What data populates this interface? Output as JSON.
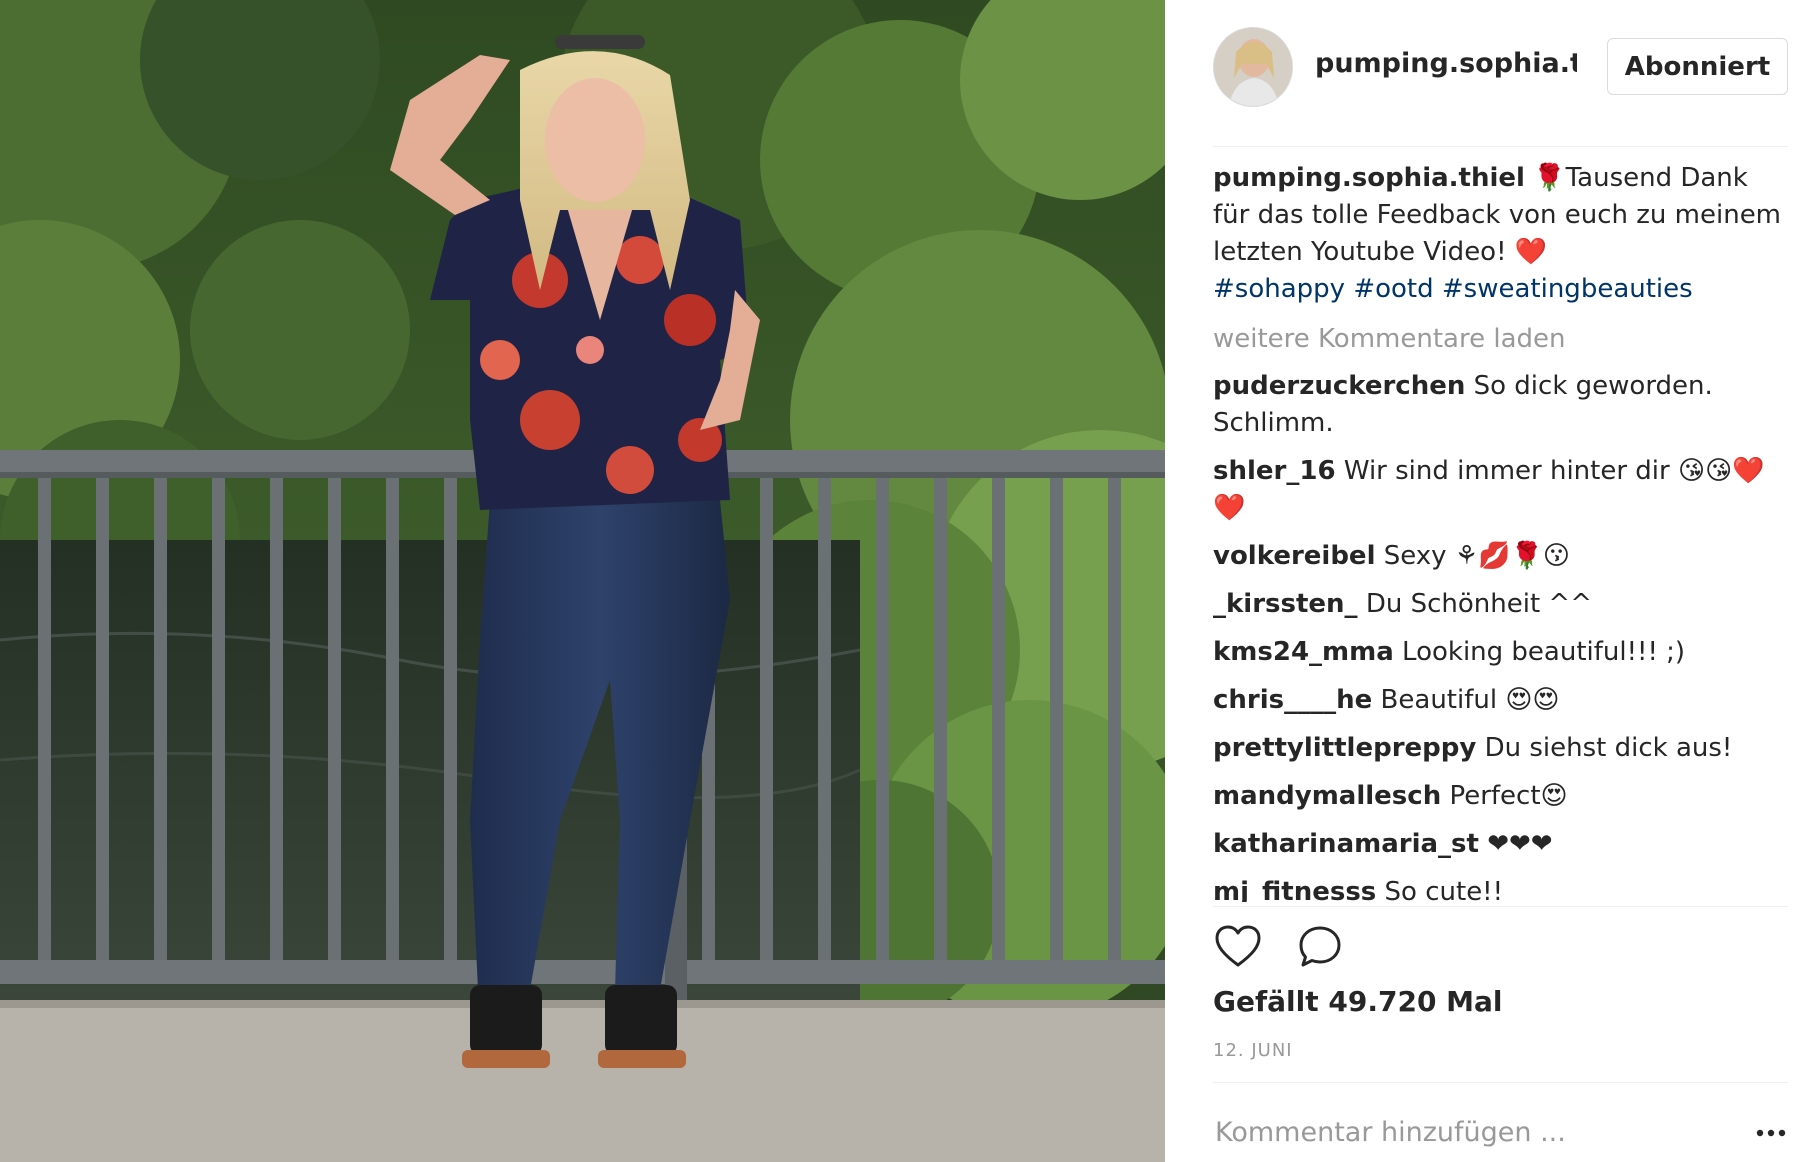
{
  "photo": {
    "alt": "Woman in floral blouse and jeans on a bridge"
  },
  "post": {
    "header_username": "pumping.sophia.thiel",
    "follow_label": "Abonniert",
    "caption": {
      "username": "pumping.sophia.thiel",
      "text": " 🌹Tausend Dank für das tolle Feedback von euch zu meinem letzten Youtube Video! ❤️",
      "hashtags": [
        "#sohappy",
        "#ootd",
        "#sweatingbeauties"
      ]
    },
    "load_more": "weitere Kommentare laden",
    "comments": [
      {
        "username": "puderzuckerchen",
        "text": "So dick geworden. Schlimm."
      },
      {
        "username": "shler_16",
        "text": "Wir sind immer hinter dir 😘😘❤️❤️"
      },
      {
        "username": "volkereibel",
        "text": "Sexy ⚘💋🌹😗"
      },
      {
        "username": "_kirssten_",
        "text": "Du Schönheit ^^"
      },
      {
        "username": "kms24_mma",
        "text": "Looking beautiful!!! ;)"
      },
      {
        "username": "chris____he",
        "text": "Beautiful 😍😍"
      },
      {
        "username": "prettylittlepreppy",
        "text": "Du siehst dick aus!"
      },
      {
        "username": "mandymallesch",
        "text": "Perfect😍"
      },
      {
        "username": "katharinamaria_st",
        "text": "❤❤❤"
      },
      {
        "username": "mj_fitnesss",
        "text": "So cute!!"
      }
    ],
    "likes_text": "Gefällt 49.720 Mal",
    "date": "12. JUNI",
    "add_comment_placeholder": "Kommentar hinzufügen ..."
  },
  "icons": {
    "like": "heart-icon",
    "comment": "speech-bubble-icon",
    "more": "ellipsis-icon"
  },
  "colors": {
    "text": "#262626",
    "muted": "#999999",
    "hashtag": "#003569",
    "border": "#dbdbdb",
    "heart": "#e3243b"
  }
}
